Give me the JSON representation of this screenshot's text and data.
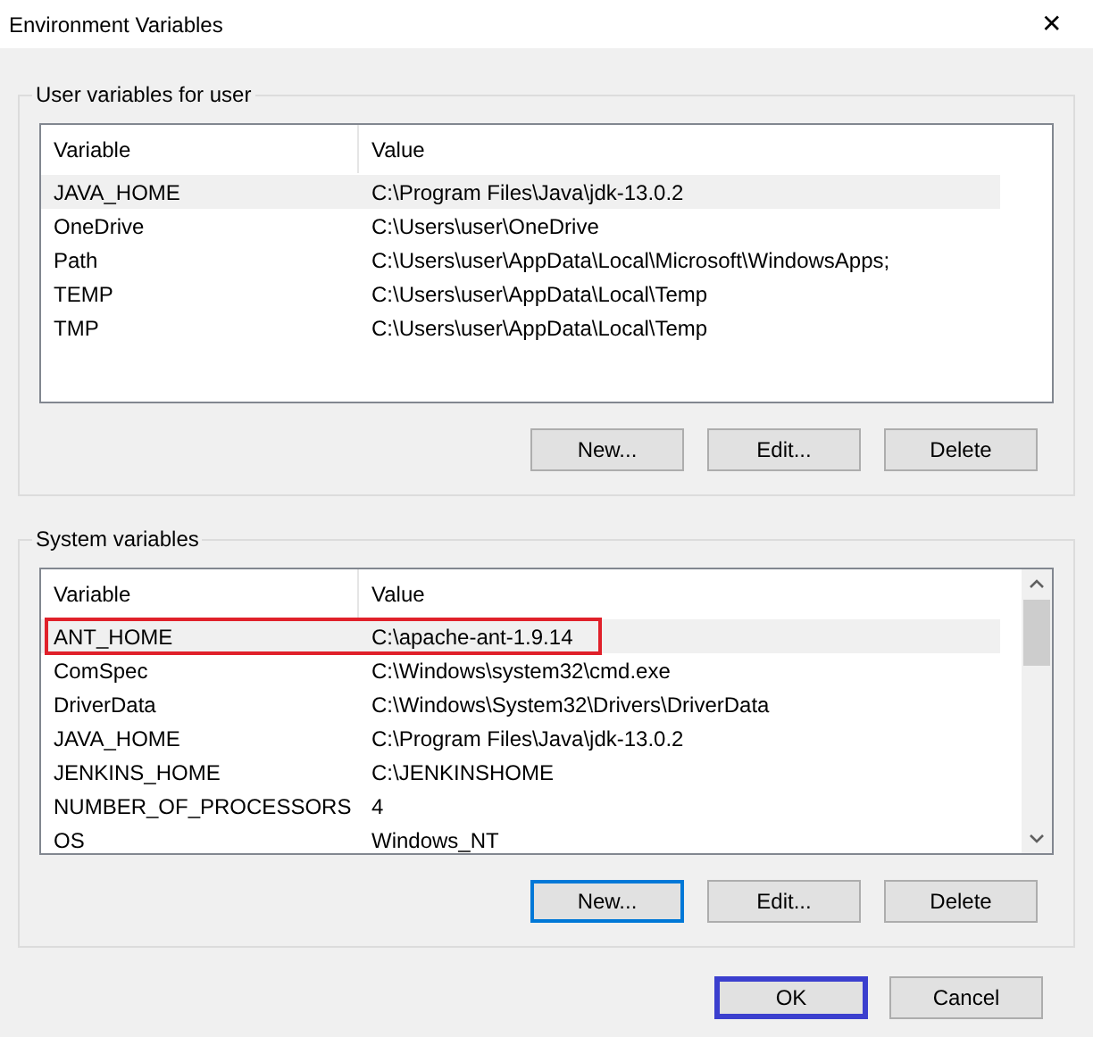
{
  "window": {
    "title": "Environment Variables",
    "close": "✕"
  },
  "user_variables": {
    "title": "User variables for user",
    "columns": [
      "Variable",
      "Value"
    ],
    "rows": [
      {
        "variable": "JAVA_HOME",
        "value": "C:\\Program Files\\Java\\jdk-13.0.2",
        "selected": true,
        "annotated": false
      },
      {
        "variable": "OneDrive",
        "value": "C:\\Users\\user\\OneDrive",
        "selected": false,
        "annotated": false
      },
      {
        "variable": "Path",
        "value": "C:\\Users\\user\\AppData\\Local\\Microsoft\\WindowsApps;",
        "selected": false,
        "annotated": false
      },
      {
        "variable": "TEMP",
        "value": "C:\\Users\\user\\AppData\\Local\\Temp",
        "selected": false,
        "annotated": false
      },
      {
        "variable": "TMP",
        "value": "C:\\Users\\user\\AppData\\Local\\Temp",
        "selected": false,
        "annotated": false
      }
    ],
    "buttons": [
      {
        "label": "New...",
        "kind": "plain"
      },
      {
        "label": "Edit...",
        "kind": "plain"
      },
      {
        "label": "Delete",
        "kind": "plain"
      }
    ]
  },
  "system_variables": {
    "title": "System variables",
    "columns": [
      "Variable",
      "Value"
    ],
    "rows": [
      {
        "variable": "ANT_HOME",
        "value": "C:\\apache-ant-1.9.14",
        "selected": true,
        "annotated": true
      },
      {
        "variable": "ComSpec",
        "value": "C:\\Windows\\system32\\cmd.exe",
        "selected": false,
        "annotated": false
      },
      {
        "variable": "DriverData",
        "value": "C:\\Windows\\System32\\Drivers\\DriverData",
        "selected": false,
        "annotated": false
      },
      {
        "variable": "JAVA_HOME",
        "value": "C:\\Program Files\\Java\\jdk-13.0.2",
        "selected": false,
        "annotated": false
      },
      {
        "variable": "JENKINS_HOME",
        "value": "C:\\JENKINSHOME",
        "selected": false,
        "annotated": false
      },
      {
        "variable": "NUMBER_OF_PROCESSORS",
        "value": "4",
        "selected": false,
        "annotated": false
      },
      {
        "variable": "OS",
        "value": "Windows_NT",
        "selected": false,
        "annotated": false
      }
    ],
    "scrollbar": true,
    "buttons": [
      {
        "label": "New...",
        "kind": "focused"
      },
      {
        "label": "Edit...",
        "kind": "plain"
      },
      {
        "label": "Delete",
        "kind": "plain"
      }
    ]
  },
  "dialog_buttons": [
    {
      "label": "OK",
      "kind": "annotated"
    },
    {
      "label": "Cancel",
      "kind": "plain"
    }
  ]
}
